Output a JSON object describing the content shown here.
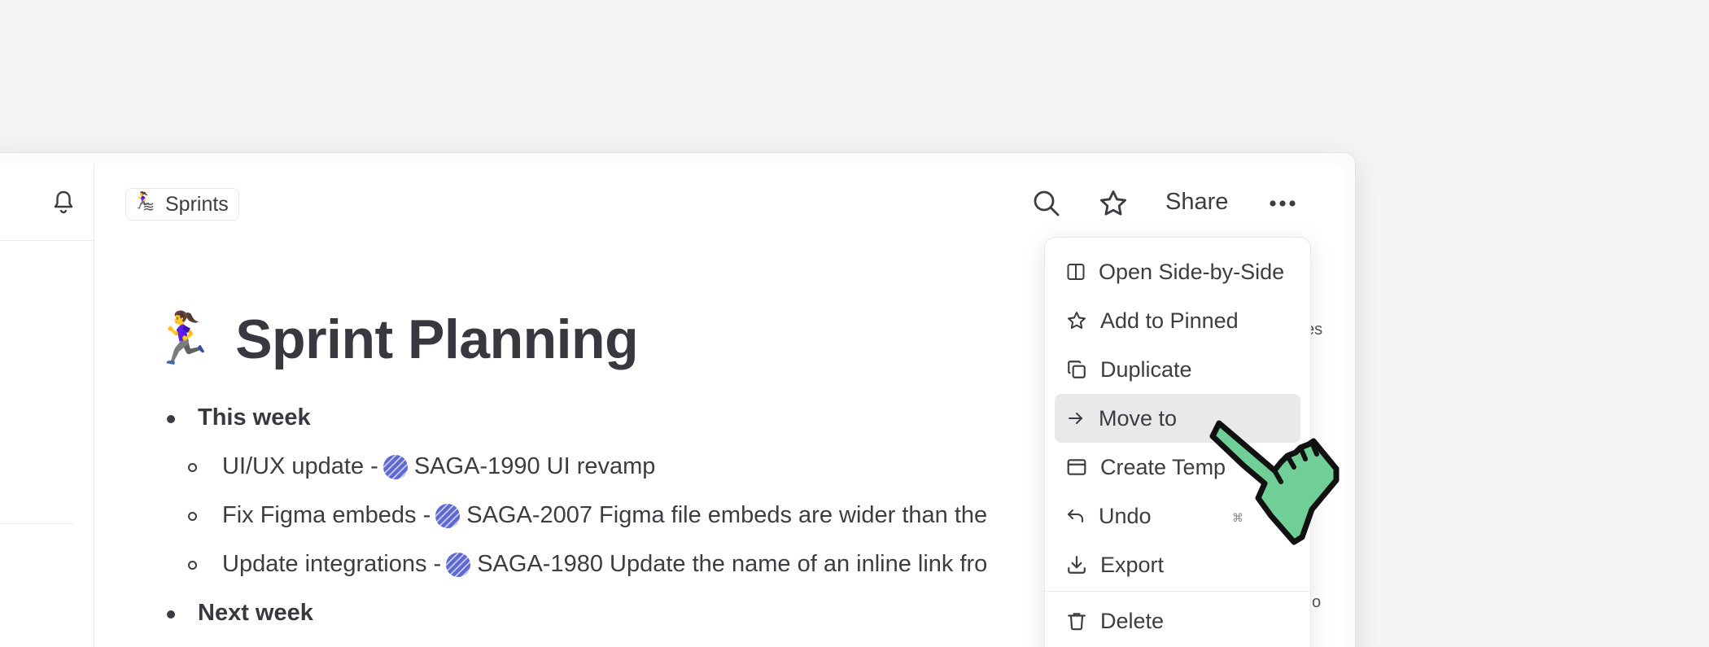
{
  "breadcrumb": {
    "label": "Sprints"
  },
  "toolbar": {
    "share_label": "Share"
  },
  "page": {
    "title_emoji": "🏃‍♀️",
    "title": "Sprint Planning"
  },
  "content": {
    "this_week": "This week",
    "items": [
      {
        "prefix": "UI/UX update - ",
        "issue": "SAGA-1990 UI revamp"
      },
      {
        "prefix": "Fix Figma embeds - ",
        "issue": "SAGA-2007 Figma file embeds are wider than the"
      },
      {
        "prefix": "Update integrations - ",
        "issue": "SAGA-1980 Update the name of an inline link fro"
      }
    ],
    "next_week": "Next week"
  },
  "side_fragments": {
    "right_top": "es",
    "right_bottom": "o"
  },
  "menu": {
    "items": [
      {
        "label": "Open Side-by-Side",
        "icon": "split-view-icon"
      },
      {
        "label": "Add to Pinned",
        "icon": "star-icon"
      },
      {
        "label": "Duplicate",
        "icon": "duplicate-icon"
      },
      {
        "label": "Move to",
        "icon": "arrow-right-icon"
      },
      {
        "label": "Create Temp",
        "icon": "template-icon"
      },
      {
        "label": "Undo",
        "icon": "undo-icon"
      },
      {
        "label": "Export",
        "icon": "export-icon"
      },
      {
        "label": "Delete",
        "icon": "trash-icon"
      }
    ],
    "shortcut_hint": "⌘"
  }
}
